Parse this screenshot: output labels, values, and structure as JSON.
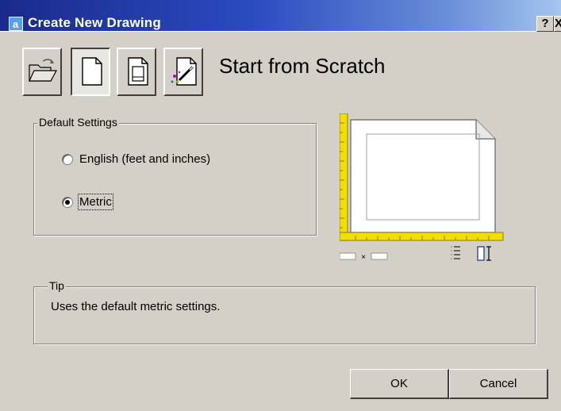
{
  "window": {
    "title": "Create New Drawing",
    "help_glyph": "?",
    "close_glyph": "X"
  },
  "toolbar": {
    "items": [
      {
        "name": "open-drawing",
        "icon": "folder-open-icon"
      },
      {
        "name": "start-from-scratch",
        "icon": "blank-page-icon",
        "active": true
      },
      {
        "name": "use-template",
        "icon": "template-page-icon"
      },
      {
        "name": "use-wizard",
        "icon": "wizard-page-icon"
      }
    ],
    "heading": "Start from Scratch"
  },
  "default_settings": {
    "group_label": "Default Settings",
    "options": [
      {
        "label": "English (feet and inches)",
        "checked": false
      },
      {
        "label": "Metric",
        "checked": true
      }
    ]
  },
  "preview": {
    "size_separator": "×",
    "icons": [
      "list-lines-icon",
      "height-bracket-icon"
    ],
    "ruler_color": "#f0e000"
  },
  "tip": {
    "group_label": "Tip",
    "text": "Uses the default metric settings."
  },
  "buttons": {
    "ok": "OK",
    "cancel": "Cancel"
  }
}
